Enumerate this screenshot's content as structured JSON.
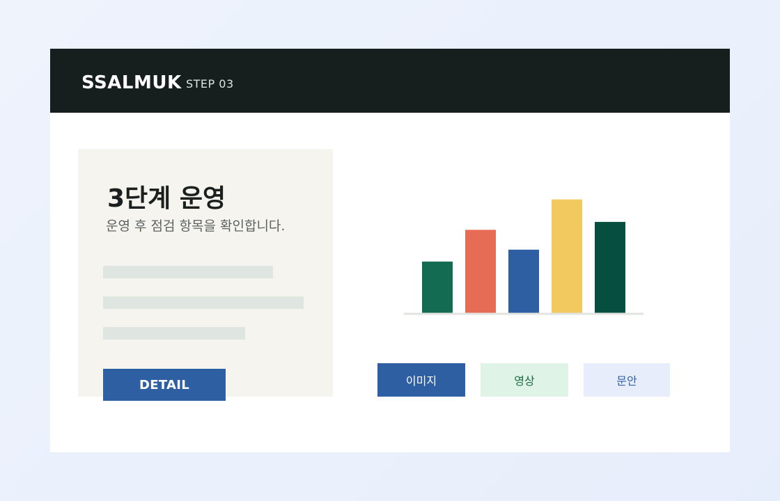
{
  "header": {
    "brand": "SSALMUK",
    "step": "STEP 03"
  },
  "panel": {
    "title": "3단계 운영",
    "subtitle": "운영 후 점검 항목을 확인합니다.",
    "detail_button": "DETAIL"
  },
  "tags": [
    {
      "label": "이미지"
    },
    {
      "label": "영상"
    },
    {
      "label": "문안"
    }
  ],
  "colors": {
    "header_bg": "#171f1e",
    "accent_blue": "#2f5fa3",
    "panel_bg": "#f5f4ef"
  },
  "chart_data": {
    "type": "bar",
    "categories": [
      "",
      "",
      "",
      "",
      ""
    ],
    "values": [
      78,
      126,
      96,
      172,
      138
    ],
    "colors": [
      "#136c52",
      "#e76c55",
      "#2f5fa3",
      "#f2c95e",
      "#064f40"
    ],
    "ylim": [
      0,
      200
    ],
    "grid": false,
    "legend": "none"
  }
}
